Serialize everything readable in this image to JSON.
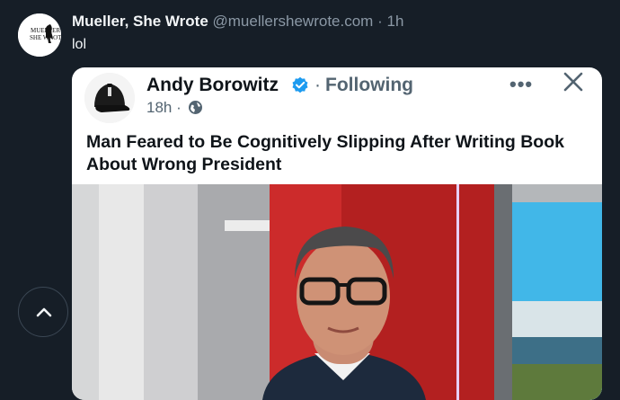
{
  "post": {
    "author_name": "Mueller, She Wrote",
    "handle": "@muellershewrote.com",
    "separator": "·",
    "time": "1h",
    "text": "lol",
    "avatar_logo_text": "MUELLER SHE WROTE"
  },
  "embedded": {
    "author_name": "Andy Borowitz",
    "separator": "·",
    "follow_status": "Following",
    "more_label": "•••",
    "time": "18h",
    "meta_separator": "·",
    "headline": "Man Feared to Be Cognitively Slipping After Writing Book About Wrong President",
    "photo": "news anchor in glasses at a studio desk"
  },
  "icons": {
    "verified": "verified-badge-icon",
    "close": "close-icon",
    "globe": "globe-icon",
    "scroll_up": "chevron-up-icon"
  },
  "colors": {
    "background": "#161e27",
    "verified": "#1d9bf0",
    "muted": "#8b98a5"
  }
}
